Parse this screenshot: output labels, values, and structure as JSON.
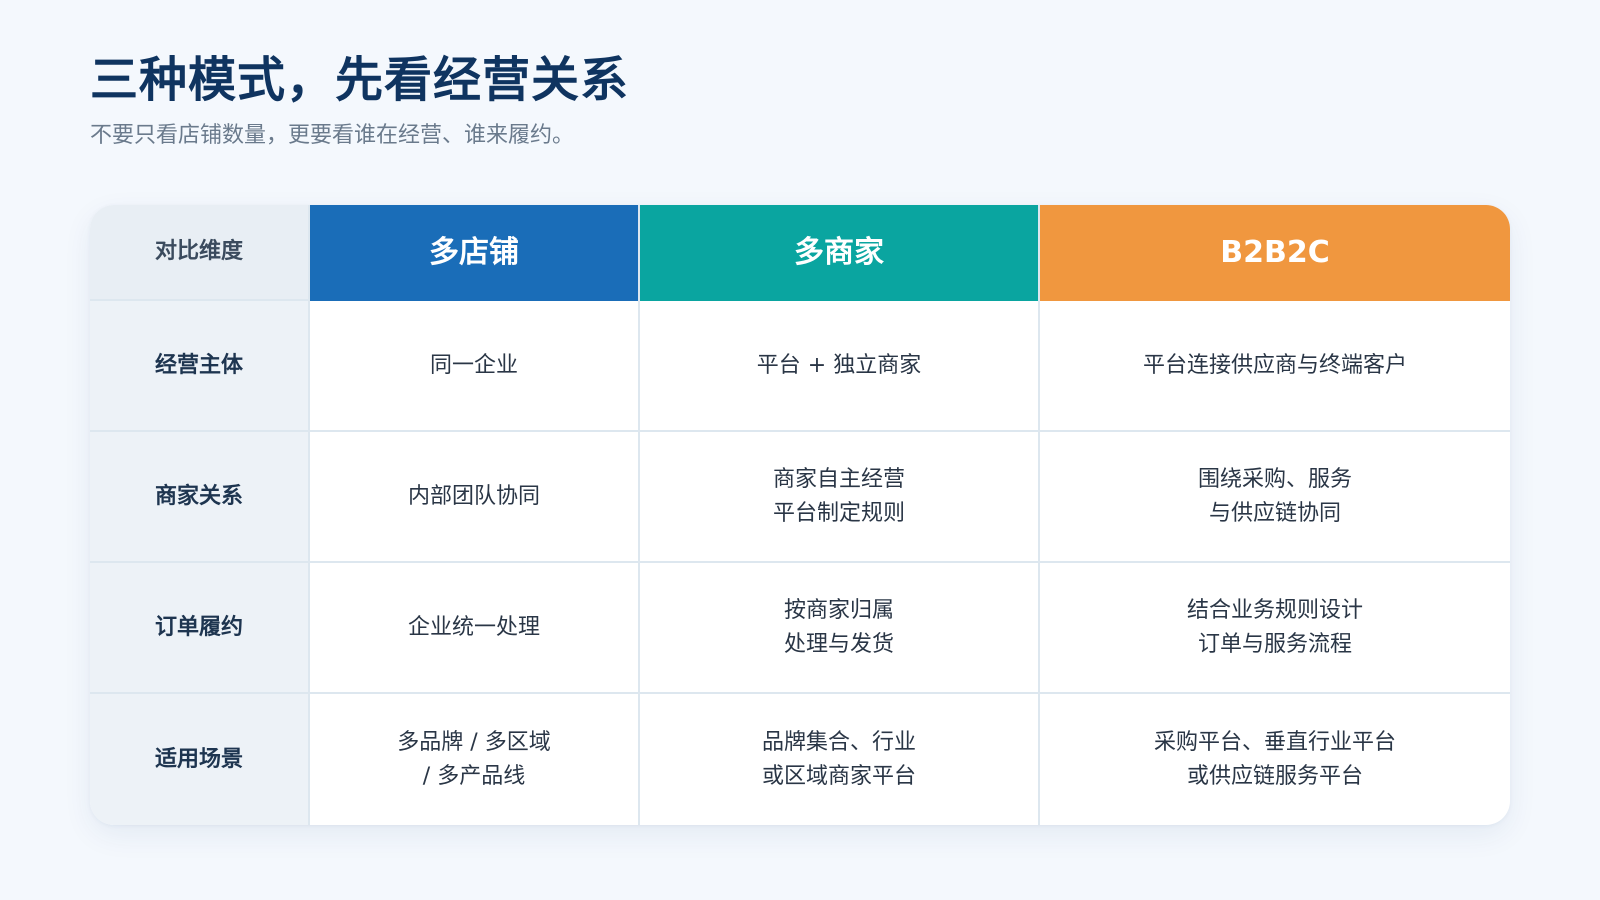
{
  "header": {
    "title": "三种模式，先看经营关系",
    "subtitle": "不要只看店铺数量，更要看谁在经营、谁来履约。"
  },
  "table": {
    "corner_label": "对比维度",
    "columns": [
      {
        "label": "多店铺",
        "color": "#1a6db8"
      },
      {
        "label": "多商家",
        "color": "#0aa5a0"
      },
      {
        "label": "B2B2C",
        "color": "#f0973f"
      }
    ],
    "rows": [
      {
        "label": "经营主体",
        "cells": [
          "同一企业",
          "平台 + 独立商家",
          "平台连接供应商与终端客户"
        ]
      },
      {
        "label": "商家关系",
        "cells": [
          "内部团队协同",
          "商家自主经营\n平台制定规则",
          "围绕采购、服务\n与供应链协同"
        ]
      },
      {
        "label": "订单履约",
        "cells": [
          "企业统一处理",
          "按商家归属\n处理与发货",
          "结合业务规则设计\n订单与服务流程"
        ]
      },
      {
        "label": "适用场景",
        "cells": [
          "多品牌 / 多区域\n/ 多产品线",
          "品牌集合、行业\n或区域商家平台",
          "采购平台、垂直行业平台\n或供应链服务平台"
        ]
      }
    ]
  }
}
